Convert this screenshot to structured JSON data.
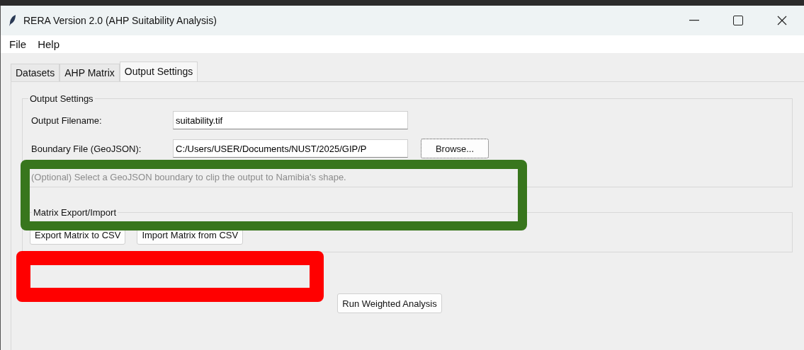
{
  "window": {
    "title": "RERA Version 2.0 (AHP Suitability Analysis)"
  },
  "menu": [
    "File",
    "Help"
  ],
  "tabs": [
    {
      "label": "Datasets",
      "selected": false
    },
    {
      "label": "AHP Matrix",
      "selected": false
    },
    {
      "label": "Output Settings",
      "selected": true
    }
  ],
  "output_settings": {
    "title": "Output Settings",
    "fields": [
      {
        "label": "Output Filename:",
        "value": "suitability.tif"
      },
      {
        "label": "Boundary File (GeoJSON):",
        "value": "C:/Users/USER/Documents/NUST/2025/GIP/P",
        "button": "Browse..."
      }
    ],
    "hint": "(Optional) Select a GeoJSON boundary to clip the output to Namibia's shape."
  },
  "matrix_export_import": {
    "title": "Matrix Export/Import",
    "buttons": [
      "Export Matrix to CSV",
      "Import Matrix from CSV"
    ]
  },
  "run_button": "Run Weighted Analysis",
  "annotations": [
    {
      "kind": "outline",
      "color": "#38761d"
    },
    {
      "kind": "outline",
      "color": "#ff0000"
    }
  ]
}
